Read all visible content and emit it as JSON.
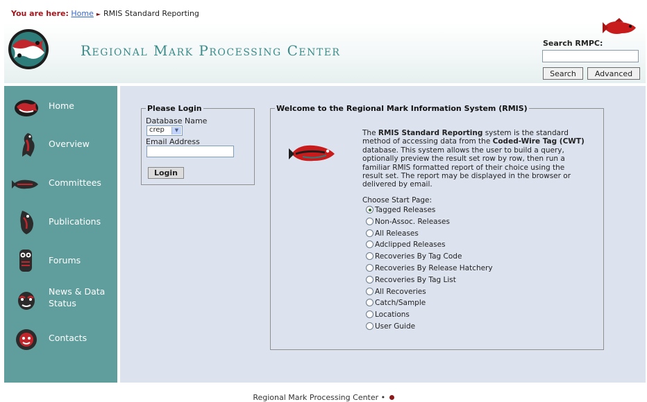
{
  "breadcrumb": {
    "prefix": "You are here:",
    "home": "Home",
    "current": "RMIS Standard Reporting"
  },
  "header": {
    "title": "Regional Mark Processing Center",
    "search_label": "Search RMPC:",
    "search_value": "",
    "search_button": "Search",
    "advanced_button": "Advanced"
  },
  "sidebar": {
    "items": [
      {
        "label": "Home",
        "icon": "salmon-emblem-icon"
      },
      {
        "label": "Overview",
        "icon": "eagle-icon"
      },
      {
        "label": "Committees",
        "icon": "fish-icon"
      },
      {
        "label": "Publications",
        "icon": "orca-icon"
      },
      {
        "label": "Forums",
        "icon": "owl-icon"
      },
      {
        "label": "News & Data Status",
        "icon": "mask-icon"
      },
      {
        "label": "Contacts",
        "icon": "sun-mask-icon"
      }
    ]
  },
  "login": {
    "legend": "Please Login",
    "db_label": "Database Name",
    "db_value": "crep",
    "email_label": "Email Address",
    "email_value": "",
    "button": "Login"
  },
  "welcome": {
    "legend": "Welcome to the Regional Mark Information System (RMIS)",
    "intro_1": "The ",
    "intro_b1": "RMIS Standard Reporting",
    "intro_2": " system is the standard method of accessing data from the ",
    "intro_b2": "Coded-Wire Tag (CWT)",
    "intro_3": " database. This system allows the user to build a query, optionally preview the result set row by row, then run a familiar RMIS formatted report of their choice using the result set. The report may be displayed in the browser or delivered by email.",
    "choose_label": "Choose Start Page:",
    "options": [
      {
        "label": "Tagged Releases",
        "selected": true
      },
      {
        "label": "Non-Assoc. Releases",
        "selected": false
      },
      {
        "label": "All Releases",
        "selected": false
      },
      {
        "label": "Adclipped Releases",
        "selected": false
      },
      {
        "label": "Recoveries By Tag Code",
        "selected": false
      },
      {
        "label": "Recoveries By Release Hatchery",
        "selected": false
      },
      {
        "label": "Recoveries By Tag List",
        "selected": false
      },
      {
        "label": "All Recoveries",
        "selected": false
      },
      {
        "label": "Catch/Sample",
        "selected": false
      },
      {
        "label": "Locations",
        "selected": false
      },
      {
        "label": "User Guide",
        "selected": false
      }
    ]
  },
  "footer": {
    "text": "Regional Mark Processing Center •"
  },
  "colors": {
    "sidebar_bg": "#5f9e9c",
    "content_bg": "#dde3ee",
    "title_color": "#3c8c8a",
    "breadcrumb_accent": "#a8141b",
    "link": "#3366cc"
  }
}
